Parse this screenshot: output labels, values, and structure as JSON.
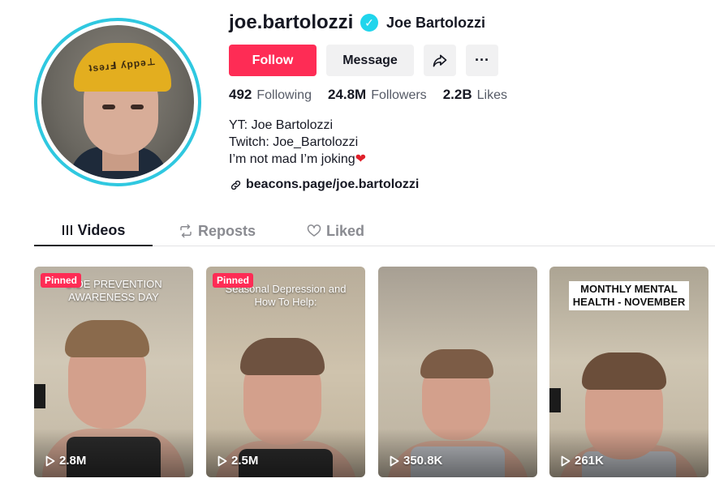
{
  "profile": {
    "username": "joe.bartolozzi",
    "nickname": "Joe Bartolozzi",
    "verified_icon": "check-icon",
    "accent_color": "#fe2c55",
    "avatar_ring_color": "#2fc8e0"
  },
  "actions": {
    "follow_label": "Follow",
    "message_label": "Message",
    "share_icon": "share-icon",
    "more_icon": "more-dots-icon",
    "more_glyph": "···"
  },
  "stats": [
    {
      "value": "492",
      "label": "Following"
    },
    {
      "value": "24.8M",
      "label": "Followers"
    },
    {
      "value": "2.2B",
      "label": "Likes"
    }
  ],
  "bio": {
    "line1": "YT: Joe Bartolozzi",
    "line2": "Twitch: Joe_Bartolozzi",
    "line3": "I’m not mad I’m joking",
    "heart": "❤"
  },
  "link": {
    "text": "beacons.page/joe.bartolozzi",
    "icon": "link-icon"
  },
  "tabs": [
    {
      "label": "Videos",
      "icon": "grid-icon",
      "active": true
    },
    {
      "label": "Reposts",
      "icon": "repost-icon",
      "active": false
    },
    {
      "label": "Liked",
      "icon": "heart-outline-icon",
      "active": false
    }
  ],
  "videos": [
    {
      "pinned": "Pinned",
      "overlay": "CIDE PREVENTION AWARENESS DAY",
      "views": "2.8M"
    },
    {
      "pinned": "Pinned",
      "overlay": "Seasonal Depression and How To Help:",
      "views": "2.5M"
    },
    {
      "pinned": "",
      "overlay": "",
      "views": "350.8K"
    },
    {
      "pinned": "",
      "overlay": "MONTHLY MENTAL HEALTH - NOVEMBER",
      "views": "261K"
    }
  ]
}
